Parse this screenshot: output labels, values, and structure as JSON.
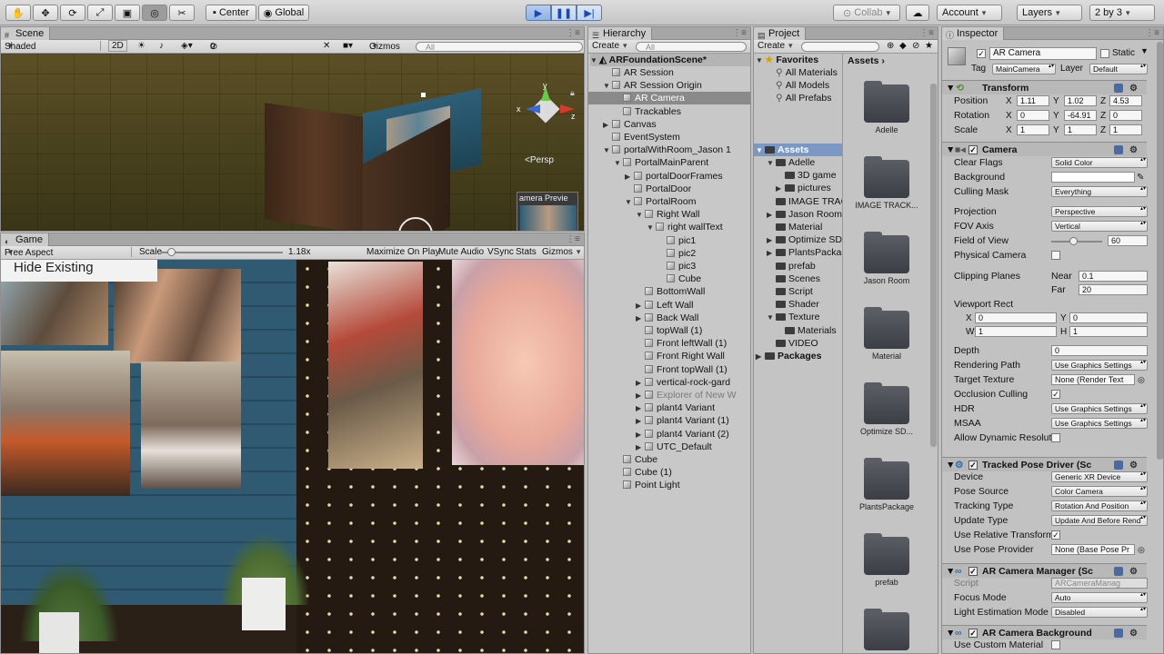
{
  "toolbar": {
    "pivot": "Center",
    "space": "Global",
    "collab": "Collab",
    "account": "Account",
    "layers": "Layers",
    "layout": "2 by 3"
  },
  "scene": {
    "tab": "Scene",
    "shading": "Shaded",
    "mode_2d": "2D",
    "hidden_count": "0",
    "gizmos": "Gizmos",
    "search_placeholder": "All",
    "persp": "<Persp",
    "camera_preview": "amera Previe",
    "axis_y": "y",
    "axis_x": "x",
    "axis_z": "z"
  },
  "game": {
    "tab": "Game",
    "aspect": "Free Aspect",
    "scale_label": "Scale",
    "scale_value": "1.18x",
    "maximize": "Maximize On Play",
    "mute": "Mute Audio",
    "vsync": "VSync",
    "stats": "Stats",
    "gizmos": "Gizmos",
    "overlay_button": "Hide Existing"
  },
  "hierarchy": {
    "tab": "Hierarchy",
    "create": "Create",
    "search_placeholder": "All",
    "scene_name": "ARFoundationScene*",
    "items": [
      {
        "label": "AR Session",
        "indent": 2,
        "arrow": ""
      },
      {
        "label": "AR Session Origin",
        "indent": 2,
        "arrow": "▼"
      },
      {
        "label": "AR Camera",
        "indent": 3,
        "arrow": "",
        "selected": true
      },
      {
        "label": "Trackables",
        "indent": 3,
        "arrow": ""
      },
      {
        "label": "Canvas",
        "indent": 2,
        "arrow": "▶"
      },
      {
        "label": "EventSystem",
        "indent": 2,
        "arrow": ""
      },
      {
        "label": "portalWithRoom_Jason 1",
        "indent": 2,
        "arrow": "▼"
      },
      {
        "label": "PortalMainParent",
        "indent": 3,
        "arrow": "▼"
      },
      {
        "label": "portalDoorFrames",
        "indent": 4,
        "arrow": "▶"
      },
      {
        "label": "PortalDoor",
        "indent": 4,
        "arrow": ""
      },
      {
        "label": "PortalRoom",
        "indent": 4,
        "arrow": "▼"
      },
      {
        "label": "Right Wall",
        "indent": 5,
        "arrow": "▼"
      },
      {
        "label": "right wallText",
        "indent": 6,
        "arrow": "▼"
      },
      {
        "label": "pic1",
        "indent": 7,
        "arrow": ""
      },
      {
        "label": "pic2",
        "indent": 7,
        "arrow": ""
      },
      {
        "label": "pic3",
        "indent": 7,
        "arrow": ""
      },
      {
        "label": "Cube",
        "indent": 7,
        "arrow": ""
      },
      {
        "label": "BottomWall",
        "indent": 5,
        "arrow": ""
      },
      {
        "label": "Left Wall",
        "indent": 5,
        "arrow": "▶"
      },
      {
        "label": "Back Wall",
        "indent": 5,
        "arrow": "▶"
      },
      {
        "label": "topWall (1)",
        "indent": 5,
        "arrow": ""
      },
      {
        "label": "Front leftWall (1)",
        "indent": 5,
        "arrow": ""
      },
      {
        "label": "Front Right Wall",
        "indent": 5,
        "arrow": ""
      },
      {
        "label": "Front topWall (1)",
        "indent": 5,
        "arrow": ""
      },
      {
        "label": "vertical-rock-gard",
        "indent": 5,
        "arrow": "▶"
      },
      {
        "label": "Explorer of New W",
        "indent": 5,
        "arrow": "▶",
        "dim": true
      },
      {
        "label": "plant4 Variant",
        "indent": 5,
        "arrow": "▶"
      },
      {
        "label": "plant4 Variant (1)",
        "indent": 5,
        "arrow": "▶"
      },
      {
        "label": "plant4 Variant (2)",
        "indent": 5,
        "arrow": "▶"
      },
      {
        "label": "UTC_Default",
        "indent": 5,
        "arrow": "▶"
      },
      {
        "label": "Cube",
        "indent": 3,
        "arrow": ""
      },
      {
        "label": "Cube (1)",
        "indent": 3,
        "arrow": ""
      },
      {
        "label": "Point Light",
        "indent": 3,
        "arrow": ""
      }
    ]
  },
  "project": {
    "tab": "Project",
    "create": "Create",
    "favorites": "Favorites",
    "fav_items": [
      "All Materials",
      "All Models",
      "All Prefabs"
    ],
    "assets_root": "Assets",
    "tree": [
      {
        "label": "Adelle",
        "indent": 1,
        "arrow": "▼"
      },
      {
        "label": "3D game",
        "indent": 2,
        "arrow": ""
      },
      {
        "label": "pictures",
        "indent": 2,
        "arrow": "▶"
      },
      {
        "label": "IMAGE TRAC",
        "indent": 1,
        "arrow": ""
      },
      {
        "label": "Jason Room",
        "indent": 1,
        "arrow": "▶"
      },
      {
        "label": "Material",
        "indent": 1,
        "arrow": ""
      },
      {
        "label": "Optimize SD",
        "indent": 1,
        "arrow": "▶"
      },
      {
        "label": "PlantsPackag",
        "indent": 1,
        "arrow": "▶"
      },
      {
        "label": "prefab",
        "indent": 1,
        "arrow": ""
      },
      {
        "label": "Scenes",
        "indent": 1,
        "arrow": ""
      },
      {
        "label": "Script",
        "indent": 1,
        "arrow": ""
      },
      {
        "label": "Shader",
        "indent": 1,
        "arrow": ""
      },
      {
        "label": "Texture",
        "indent": 1,
        "arrow": "▼"
      },
      {
        "label": "Materials",
        "indent": 2,
        "arrow": ""
      },
      {
        "label": "VIDEO",
        "indent": 1,
        "arrow": ""
      }
    ],
    "packages": "Packages",
    "breadcrumb": "Assets",
    "grid": [
      "Adelle",
      "IMAGE TRACK...",
      "Jason Room",
      "Material",
      "Optimize SD...",
      "PlantsPackage",
      "prefab",
      ""
    ]
  },
  "inspector": {
    "tab": "Inspector",
    "object_name": "AR Camera",
    "static": "Static",
    "tag_label": "Tag",
    "tag_value": "MainCamera",
    "layer_label": "Layer",
    "layer_value": "Default",
    "transform": {
      "title": "Transform",
      "position_label": "Position",
      "px": "1.11",
      "py": "1.02",
      "pz": "4.53",
      "rotation_label": "Rotation",
      "rx": "0",
      "ry": "-64.91",
      "rz": "0",
      "scale_label": "Scale",
      "sx": "1",
      "sy": "1",
      "sz": "1"
    },
    "camera": {
      "title": "Camera",
      "clear_flags_label": "Clear Flags",
      "clear_flags": "Solid Color",
      "background_label": "Background",
      "culling_label": "Culling Mask",
      "culling": "Everything",
      "projection_label": "Projection",
      "projection": "Perspective",
      "fov_axis_label": "FOV Axis",
      "fov_axis": "Vertical",
      "fov_label": "Field of View",
      "fov": "60",
      "fov_slider_fraction": 0.35,
      "physical_label": "Physical Camera",
      "clipping_label": "Clipping Planes",
      "near_label": "Near",
      "near": "0.1",
      "far_label": "Far",
      "far": "20",
      "viewport_label": "Viewport Rect",
      "vx": "0",
      "vy": "0",
      "vw": "1",
      "vh": "1",
      "depth_label": "Depth",
      "depth": "0",
      "render_path_label": "Rendering Path",
      "render_path": "Use Graphics Settings",
      "target_tex_label": "Target Texture",
      "target_tex": "None (Render Text",
      "occlusion_label": "Occlusion Culling",
      "hdr_label": "HDR",
      "hdr": "Use Graphics Settings",
      "msaa_label": "MSAA",
      "msaa": "Use Graphics Settings",
      "dyn_res_label": "Allow Dynamic Resolut"
    },
    "pose_driver": {
      "title": "Tracked Pose Driver (Sc",
      "device_label": "Device",
      "device": "Generic XR Device",
      "pose_source_label": "Pose Source",
      "pose_source": "Color Camera",
      "tracking_label": "Tracking Type",
      "tracking": "Rotation And Position",
      "update_label": "Update Type",
      "update": "Update And Before Rend",
      "relative_label": "Use Relative Transform",
      "provider_label": "Use Pose Provider",
      "provider": "None (Base Pose Pr"
    },
    "cam_manager": {
      "title": "AR Camera Manager (Sc",
      "script_label": "Script",
      "script": "ARCameraManag",
      "focus_label": "Focus Mode",
      "focus": "Auto",
      "light_label": "Light Estimation Mode",
      "light": "Disabled"
    },
    "cam_background": {
      "title": "AR Camera Background",
      "custom_label": "Use Custom Material"
    }
  }
}
